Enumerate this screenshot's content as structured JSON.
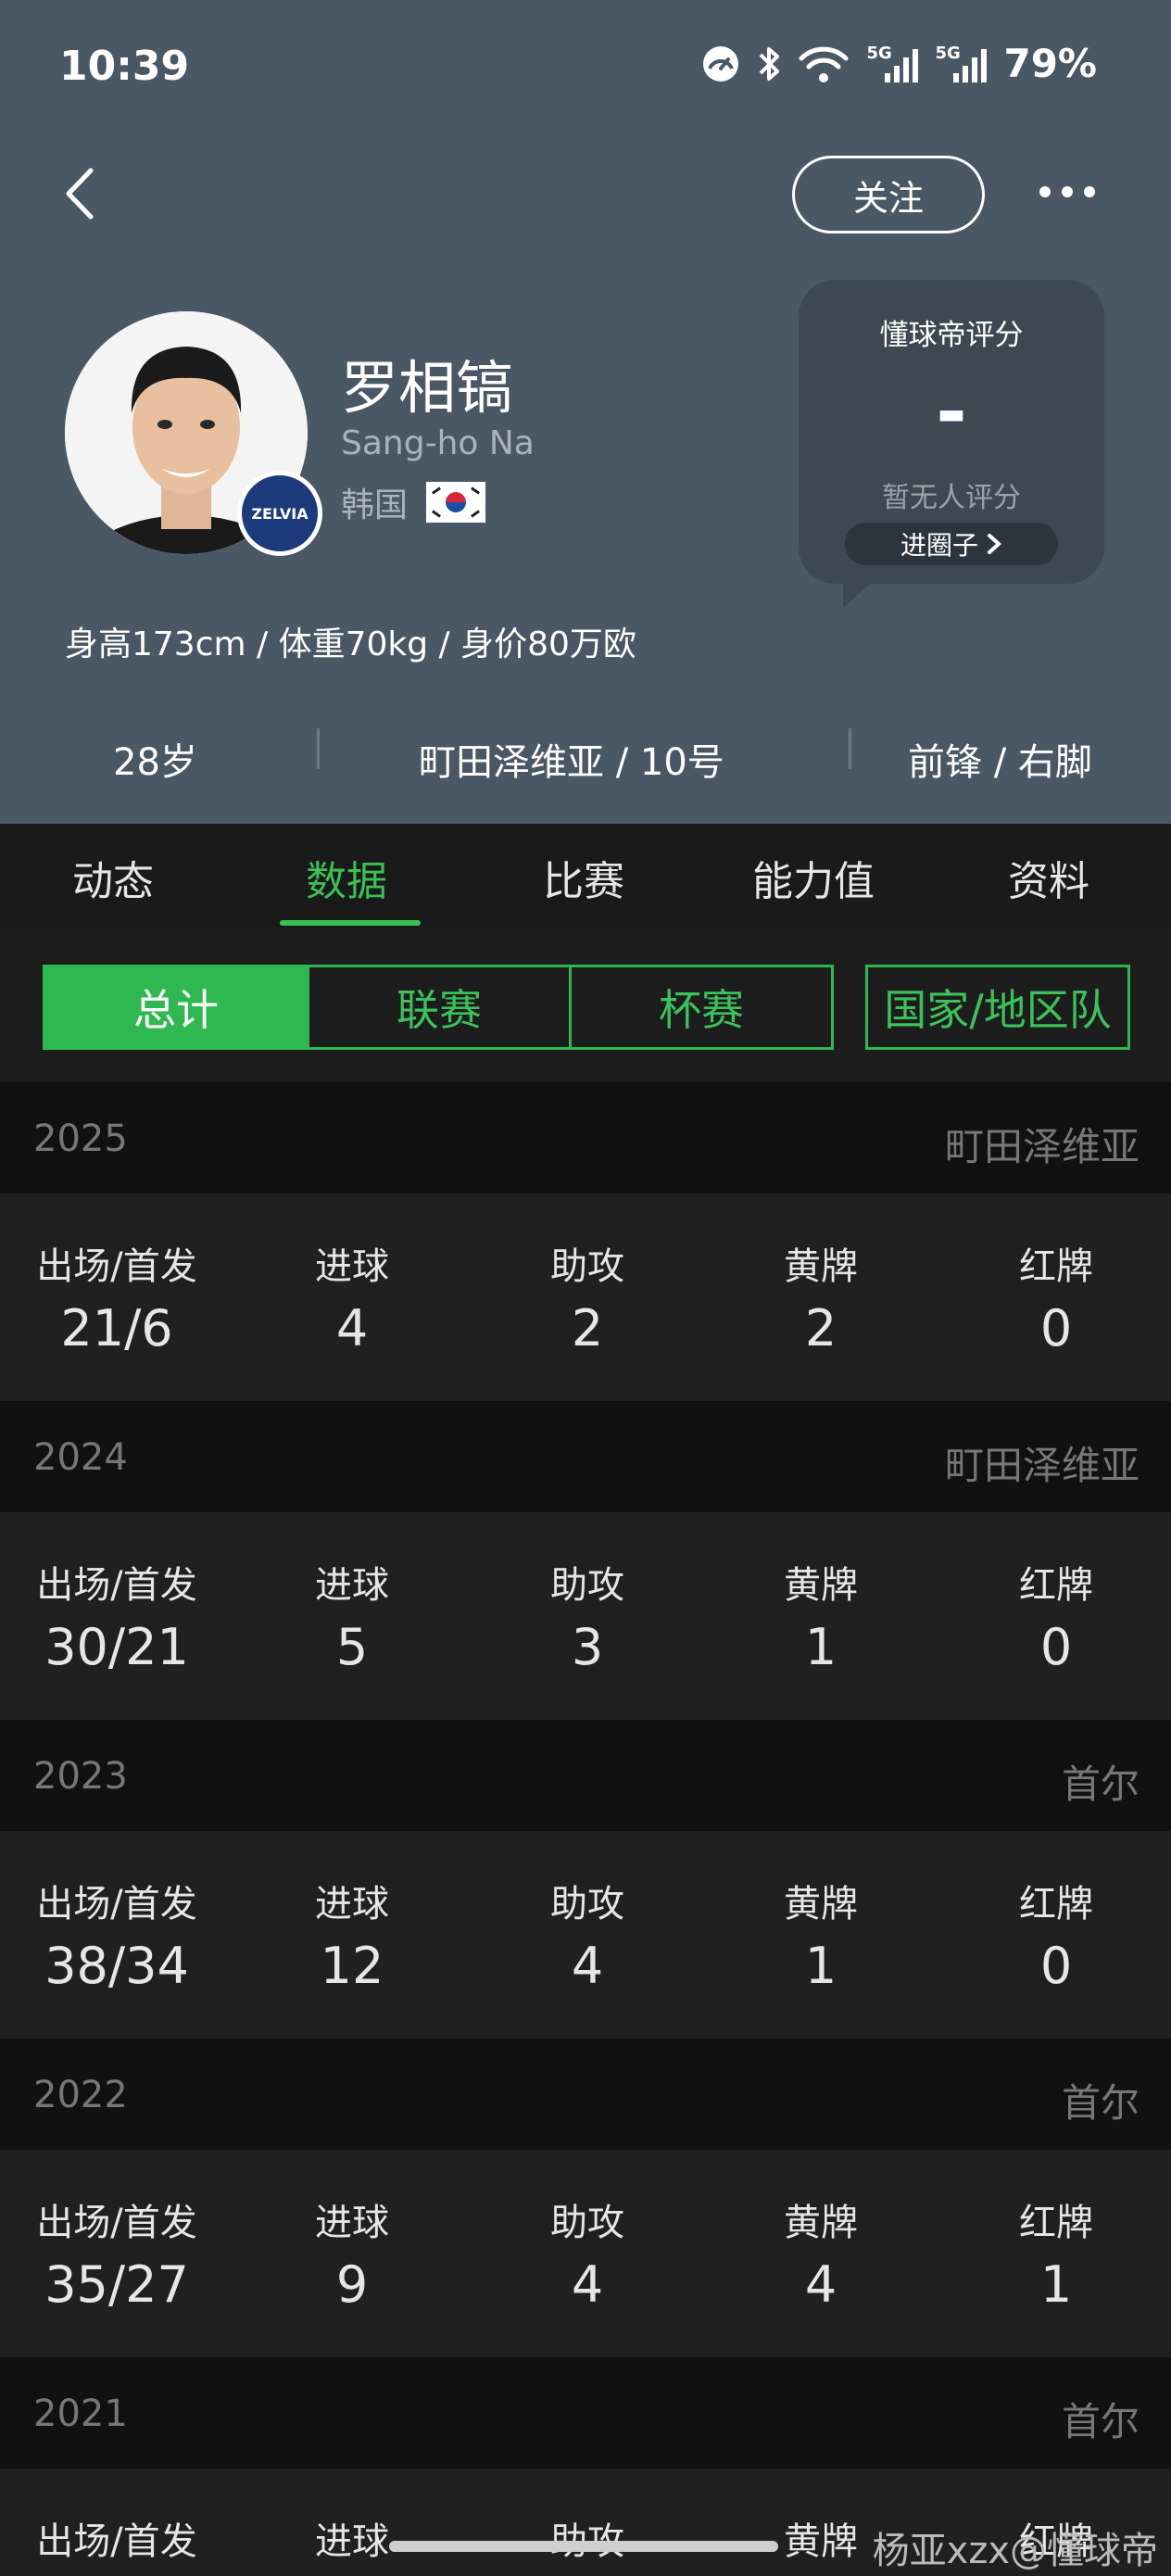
{
  "status": {
    "time": "10:39",
    "battery": "79%",
    "network_a": "5G",
    "network_b": "5G"
  },
  "header": {
    "follow_label": "关注"
  },
  "player": {
    "name_cn": "罗相镐",
    "name_en": "Sang-ho Na",
    "nation": "韩国",
    "club_badge_text": "ZELVIA",
    "body_stats": "身高173cm / 体重70kg / 身价80万欧",
    "age": "28岁",
    "club_number": "町田泽维亚 / 10号",
    "position_foot": "前锋 / 右脚"
  },
  "rating": {
    "title": "懂球帝评分",
    "value": "-",
    "note": "暂无人评分",
    "circle_label": "进圈子"
  },
  "tabs": [
    "动态",
    "数据",
    "比赛",
    "能力值",
    "资料"
  ],
  "active_tab": "数据",
  "segments": [
    "总计",
    "联赛",
    "杯赛",
    "国家/地区队"
  ],
  "active_segment": "总计",
  "stat_labels": [
    "出场/首发",
    "进球",
    "助攻",
    "黄牌",
    "红牌"
  ],
  "seasons": [
    {
      "year": "2025",
      "club": "町田泽维亚",
      "apps": "21/6",
      "goals": "4",
      "assists": "2",
      "yellow": "2",
      "red": "0"
    },
    {
      "year": "2024",
      "club": "町田泽维亚",
      "apps": "30/21",
      "goals": "5",
      "assists": "3",
      "yellow": "1",
      "red": "0"
    },
    {
      "year": "2023",
      "club": "首尔",
      "apps": "38/34",
      "goals": "12",
      "assists": "4",
      "yellow": "1",
      "red": "0"
    },
    {
      "year": "2022",
      "club": "首尔",
      "apps": "35/27",
      "goals": "9",
      "assists": "4",
      "yellow": "4",
      "red": "1"
    },
    {
      "year": "2021",
      "club": "首尔"
    }
  ],
  "watermark": "杨亚xzx@懂球帝",
  "colors": {
    "header_bg": "#4a5865",
    "accent_green": "#2fb84f",
    "page_bg": "#181818"
  }
}
